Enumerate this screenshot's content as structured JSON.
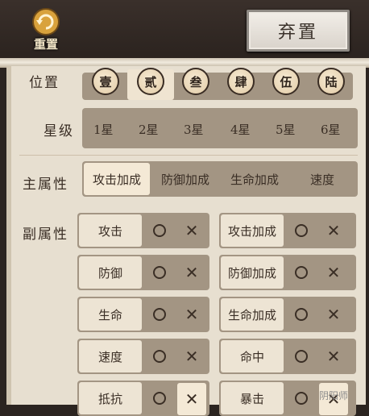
{
  "top": {
    "reset_label": "重置",
    "abandon_label": "弃置"
  },
  "position": {
    "label": "位置",
    "buttons": [
      "壹",
      "贰",
      "叁",
      "肆",
      "伍",
      "陆"
    ],
    "selected": "贰"
  },
  "star": {
    "label": "星级",
    "options": [
      "1星",
      "2星",
      "3星",
      "4星",
      "5星",
      "6星"
    ]
  },
  "main_attr": {
    "label": "主属性",
    "options": [
      "攻击加成",
      "防御加成",
      "生命加成",
      "速度"
    ],
    "selected": "攻击加成"
  },
  "sub_attr": {
    "label": "副属性",
    "left": [
      {
        "name": "攻击",
        "x_selected": false
      },
      {
        "name": "防御",
        "x_selected": false
      },
      {
        "name": "生命",
        "x_selected": false
      },
      {
        "name": "速度",
        "x_selected": false
      },
      {
        "name": "抵抗",
        "x_selected": true
      }
    ],
    "right": [
      {
        "name": "攻击加成",
        "x_selected": false
      },
      {
        "name": "防御加成",
        "x_selected": false
      },
      {
        "name": "生命加成",
        "x_selected": false
      },
      {
        "name": "命中",
        "x_selected": false
      },
      {
        "name": "暴击",
        "x_selected": true
      }
    ]
  },
  "watermark": "阴阳师"
}
